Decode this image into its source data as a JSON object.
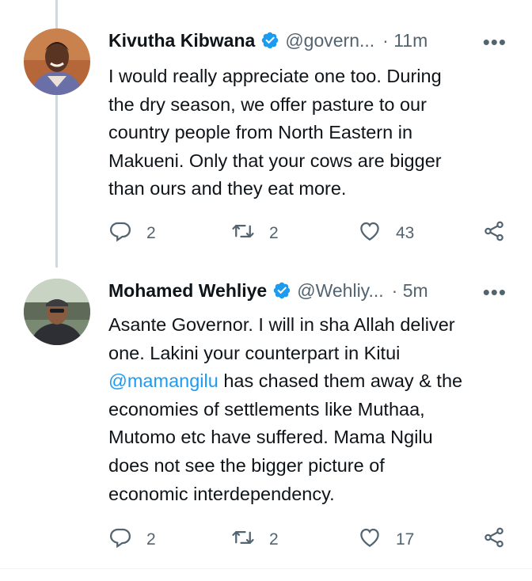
{
  "tweets": [
    {
      "name": "Kivutha Kibwana",
      "handle": "@govern...",
      "time": "· 11m",
      "body_lines": [
        "I would really appreciate one too. During",
        "the dry season, we offer pasture to our",
        "country people from North Eastern in",
        "Makueni. Only that your cows are bigger",
        "than ours and they eat more."
      ],
      "replies": "2",
      "retweets": "2",
      "likes": "43"
    },
    {
      "name": "Mohamed Wehliye",
      "handle": "@Wehliy...",
      "time": "· 5m",
      "body_line1": "Asante Governor. I will in sha Allah deliver",
      "body_line2": "one. Lakini your counterpart in Kitui",
      "mention": "@mamangilu",
      "body_line3_rest": " has chased them away & the",
      "body_lines_after": [
        "economies of settlements like Muthaa,",
        "Mutomo etc have suffered. Mama Ngilu",
        "does not see the bigger picture of",
        "economic interdependency."
      ],
      "replies": "2",
      "retweets": "2",
      "likes": "17"
    }
  ],
  "icons": {
    "more": "more-dots-icon",
    "verified": "verified-badge-icon",
    "reply": "reply-bubble-icon",
    "retweet": "retweet-icon",
    "like": "heart-icon",
    "share": "share-icon"
  },
  "colors": {
    "link": "#1d9bf0",
    "verified": "#1d9bf0",
    "secondary_text": "#536471"
  }
}
